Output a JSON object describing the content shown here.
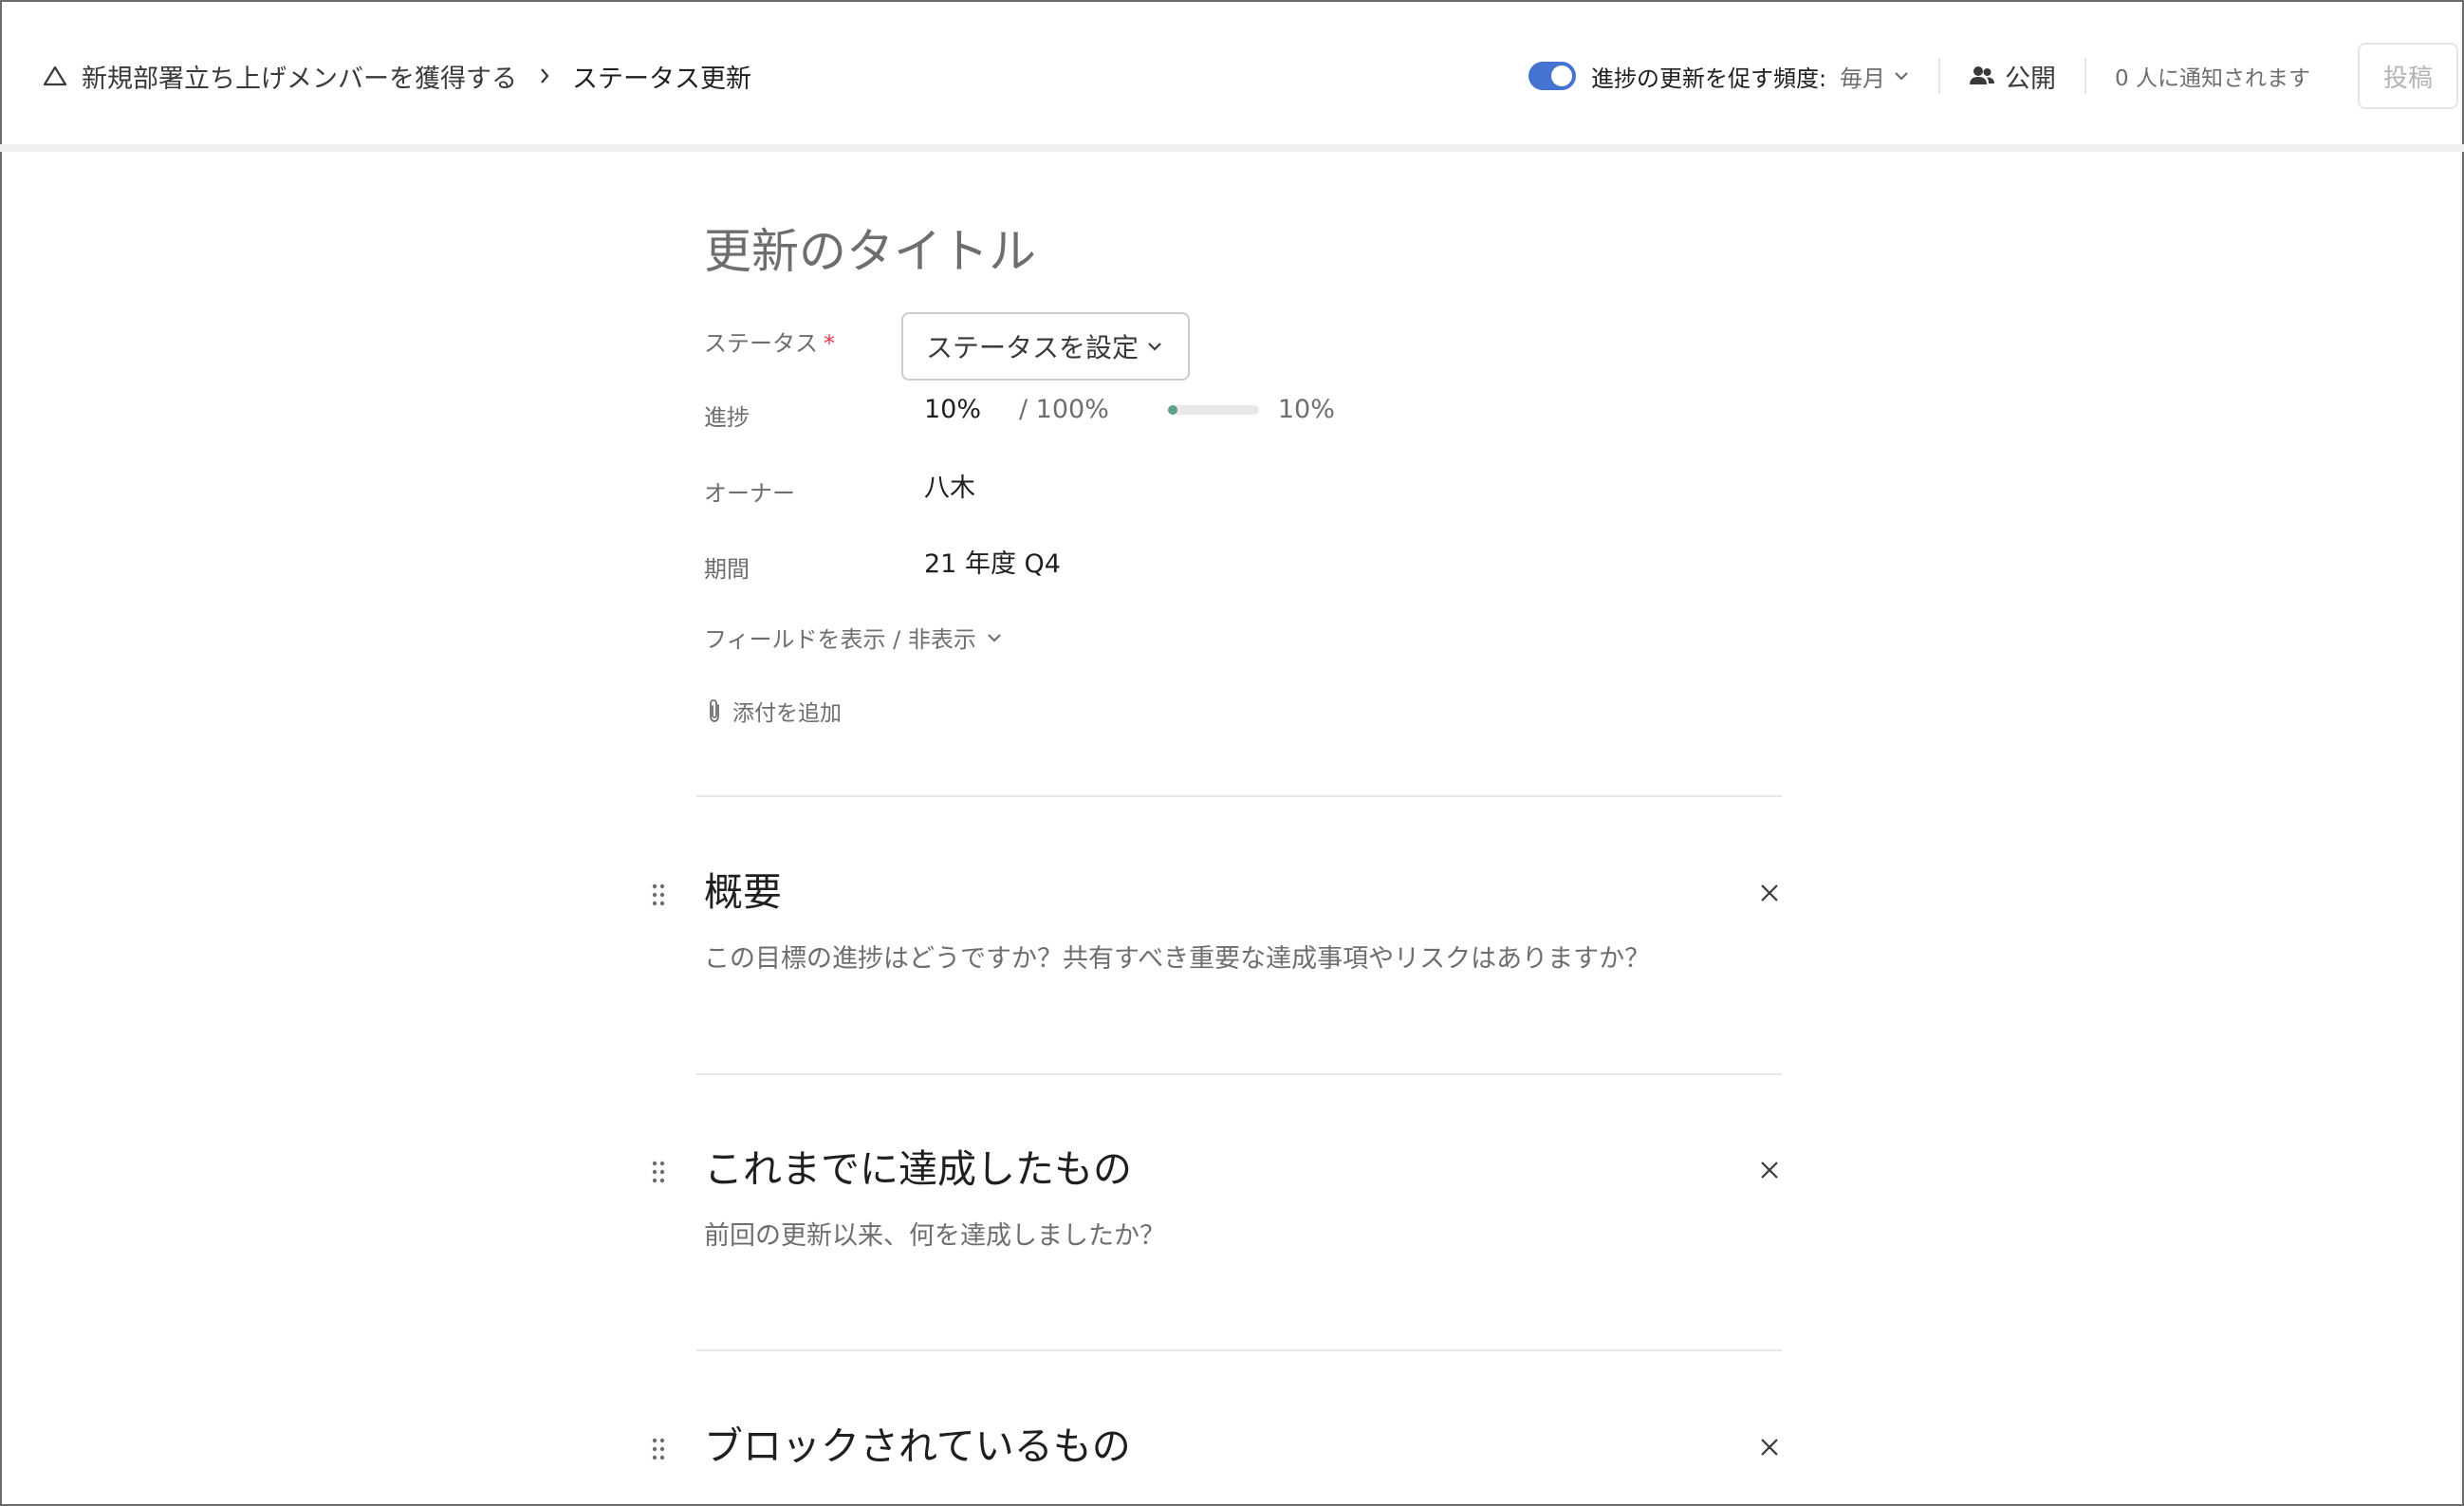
{
  "breadcrumb": {
    "goal": "新規部署立ち上げメンバーを獲得する",
    "current": "ステータス更新"
  },
  "toolbar": {
    "reminder_label": "進捗の更新を促す頻度:",
    "reminder_value": "毎月",
    "privacy": "公開",
    "notify": "0 人に通知されます",
    "post": "投稿"
  },
  "form": {
    "title_placeholder": "更新のタイトル",
    "status_label": "ステータス",
    "status_required": "*",
    "status_button": "ステータスを設定",
    "progress_label": "進捗",
    "progress_current": "10%",
    "progress_total": "/ 100%",
    "progress_fraction": 0.1,
    "progress_pct": "10%",
    "owner_label": "オーナー",
    "owner_value": "八木",
    "period_label": "期間",
    "period_value": "21 年度 Q4",
    "fields_toggle": "フィールドを表示 / 非表示",
    "attach": "添付を追加"
  },
  "sections": [
    {
      "title": "概要",
      "prompt": "この目標の進捗はどうですか？共有すべき重要な達成事項やリスクはありますか？"
    },
    {
      "title": "これまでに達成したもの",
      "prompt": "前回の更新以来、何を達成しましたか？"
    },
    {
      "title": "ブロックされているもの",
      "prompt": ""
    }
  ],
  "colors": {
    "accent": "#4573d2",
    "progress": "#5da283",
    "required": "#e8384f"
  }
}
